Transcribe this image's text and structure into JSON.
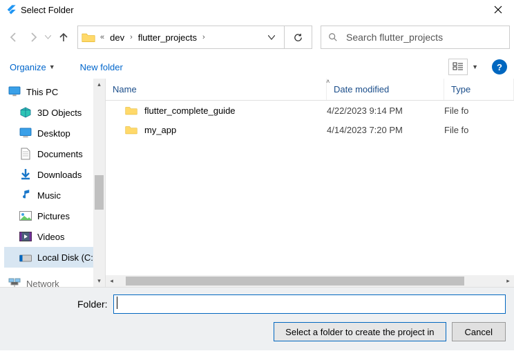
{
  "window": {
    "title": "Select Folder"
  },
  "nav": {
    "breadcrumb_ellipsis": "«",
    "crumb1": "dev",
    "crumb2": "flutter_projects"
  },
  "search": {
    "placeholder": "Search flutter_projects"
  },
  "toolbar": {
    "organize": "Organize",
    "new_folder": "New folder"
  },
  "sidebar": {
    "this_pc": "This PC",
    "items": [
      {
        "label": "3D Objects"
      },
      {
        "label": "Desktop"
      },
      {
        "label": "Documents"
      },
      {
        "label": "Downloads"
      },
      {
        "label": "Music"
      },
      {
        "label": "Pictures"
      },
      {
        "label": "Videos"
      },
      {
        "label": "Local Disk (C:)"
      },
      {
        "label": "Network"
      }
    ]
  },
  "columns": {
    "name": "Name",
    "date": "Date modified",
    "type": "Type"
  },
  "rows": [
    {
      "name": "flutter_complete_guide",
      "date": "4/22/2023 9:14 PM",
      "type": "File fo"
    },
    {
      "name": "my_app",
      "date": "4/14/2023 7:20 PM",
      "type": "File fo"
    }
  ],
  "footer": {
    "folder_label": "Folder:",
    "folder_value": "",
    "select_btn": "Select a folder to create the project in",
    "cancel_btn": "Cancel"
  }
}
